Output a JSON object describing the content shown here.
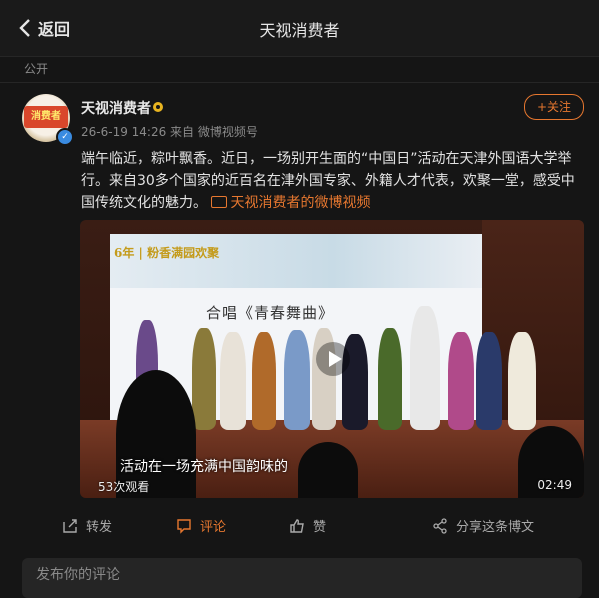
{
  "header": {
    "back_label": "返回",
    "title": "天视消费者"
  },
  "visibility": "公开",
  "post": {
    "avatar_text": "消费者",
    "author": "天视消费者",
    "meta": "26-6-19 14:26 来自 微博视频号",
    "follow_label": "+关注",
    "text": "端午临近，粽叶飘香。近日，一场别开生面的“中国日”活动在天津外国语大学举行。来自30多个国家的近百名在津外国专家、外籍人才代表，欢聚一堂，感受中国传统文化的魅力。",
    "video_link": "天视消费者的微博视频"
  },
  "video": {
    "screen_logo": "6年 | 粉香满园欢聚",
    "screen_caption": "合唱《青春舞曲》",
    "subtitle": "活动在一场充满中国韵味的",
    "views": "53次观看",
    "duration": "02:49"
  },
  "actions": {
    "repost": "转发",
    "comment": "评论",
    "like": "赞",
    "share": "分享这条博文"
  },
  "comment": {
    "placeholder": "发布你的评论"
  },
  "colors": {
    "accent": "#e6772f",
    "background": "#151515",
    "verify": "#3a8be0"
  }
}
